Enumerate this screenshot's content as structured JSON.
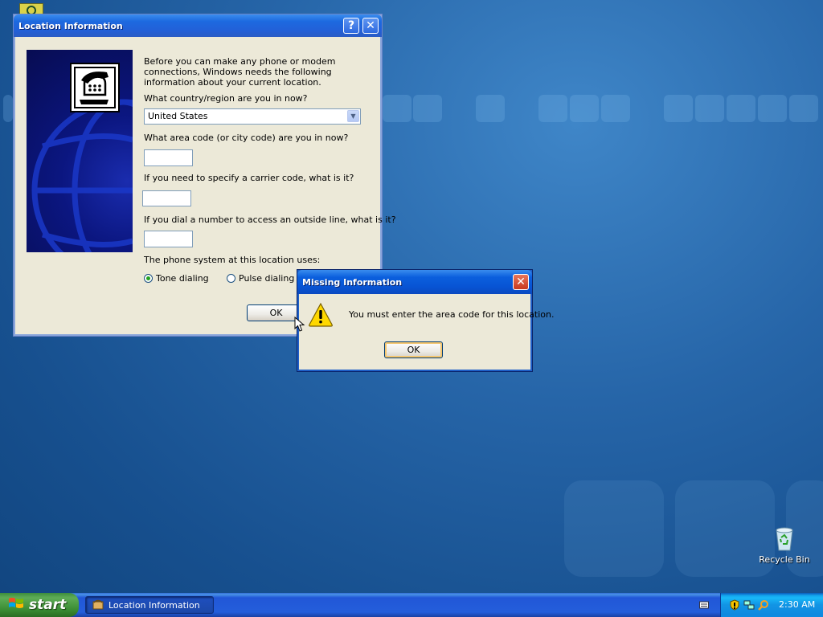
{
  "location_dialog": {
    "title": "Location Information",
    "help_btn": "?",
    "close_btn": "✕",
    "intro": "Before you can make any phone or modem connections, Windows needs the following information about your current location.",
    "country_label": "What country/region are you in now?",
    "country_value": "United States",
    "area_code_label": "What area code (or city code) are you in now?",
    "area_code_value": "",
    "carrier_label": "If you need to specify a carrier code, what is it?",
    "carrier_value": "",
    "outside_line_label": "If you dial a number to access an outside line, what is it?",
    "outside_line_value": "",
    "phone_system_label": "The phone system at this location uses:",
    "tone_label": "Tone dialing",
    "pulse_label": "Pulse dialing",
    "tone_selected": true,
    "ok_label": "OK"
  },
  "missing_dialog": {
    "title": "Missing Information",
    "close_btn": "✕",
    "message": "You must enter the area code for this location.",
    "ok_label": "OK",
    "icon": "warning-icon"
  },
  "desktop": {
    "recycle_bin_label": "Recycle Bin"
  },
  "taskbar": {
    "start_label": "start",
    "task_item_label": "Location Information",
    "clock": "2:30 AM"
  },
  "colors": {
    "xp_blue_title": "#0854d4",
    "desktop_bg": "#2665a8",
    "start_green": "#3a8c33",
    "tray_blue": "#1294e4"
  }
}
